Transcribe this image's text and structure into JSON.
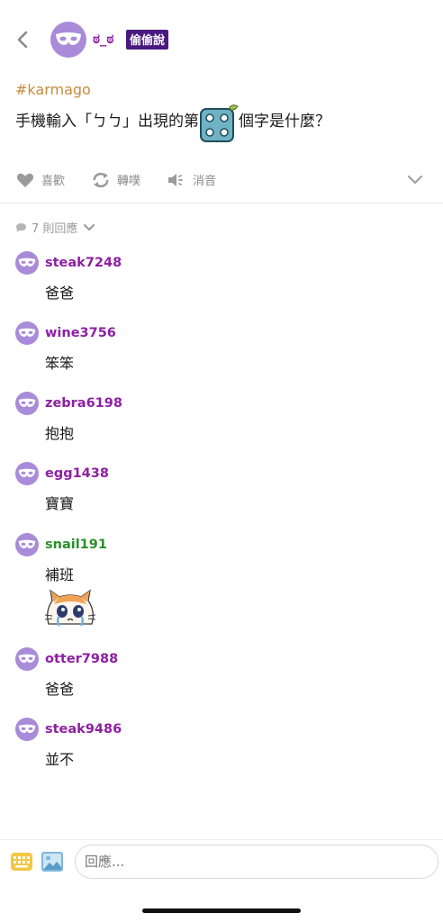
{
  "header": {
    "author_name": "ಠ_ಠ",
    "board_badge": "偷偷說"
  },
  "post": {
    "hashtag": "#karmago",
    "text_before": "手機輸入「ㄅㄅ」出現的第",
    "text_after": "個字是什麼？",
    "dice_value": 4
  },
  "actions": {
    "like_label": "喜歡",
    "repost_label": "轉噗",
    "mute_label": "消音"
  },
  "replies": {
    "count_label": "7 則回應"
  },
  "comments": [
    {
      "user": "steak7248",
      "text": "爸爸",
      "name_color": "#8e1fa3"
    },
    {
      "user": "wine3756",
      "text": "笨笨",
      "name_color": "#8e1fa3"
    },
    {
      "user": "zebra6198",
      "text": "抱抱",
      "name_color": "#8e1fa3"
    },
    {
      "user": "egg1438",
      "text": "寶寶",
      "name_color": "#8e1fa3"
    },
    {
      "user": "snail191",
      "text": "補班",
      "name_color": "#2b8f2b",
      "sticker": "crying-cat-sticker"
    },
    {
      "user": "otter7988",
      "text": "爸爸",
      "name_color": "#8e1fa3"
    },
    {
      "user": "steak9486",
      "text": "並不",
      "name_color": "#8e1fa3"
    }
  ],
  "composer": {
    "placeholder": "回應..."
  },
  "colors": {
    "avatar_bg": "#a98bd9",
    "username_purple": "#8e1fa3",
    "username_green": "#2b8f2b",
    "hashtag": "#c98a3a",
    "badge_bg": "#4a1a80"
  }
}
